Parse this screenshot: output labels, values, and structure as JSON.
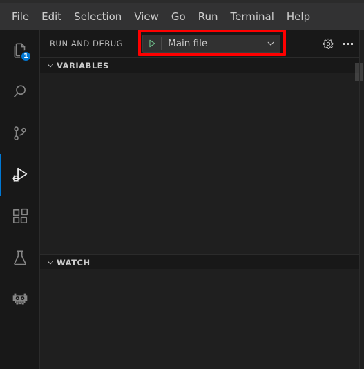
{
  "window": {
    "app": "Visual Studio Code",
    "theme_bg": "#1e1e1e",
    "accent": "#0078d4",
    "highlight_color": "#ff0000"
  },
  "menubar": {
    "items": [
      {
        "label": "File",
        "name": "menu-file"
      },
      {
        "label": "Edit",
        "name": "menu-edit"
      },
      {
        "label": "Selection",
        "name": "menu-selection"
      },
      {
        "label": "View",
        "name": "menu-view"
      },
      {
        "label": "Go",
        "name": "menu-go"
      },
      {
        "label": "Run",
        "name": "menu-run"
      },
      {
        "label": "Terminal",
        "name": "menu-terminal"
      },
      {
        "label": "Help",
        "name": "menu-help"
      }
    ]
  },
  "activitybar": {
    "items": [
      {
        "label": "Explorer",
        "icon": "files-icon",
        "badge": "1",
        "active": false
      },
      {
        "label": "Search",
        "icon": "search-icon",
        "badge": "",
        "active": false
      },
      {
        "label": "Source Control",
        "icon": "source-control-icon",
        "badge": "",
        "active": false
      },
      {
        "label": "Run and Debug",
        "icon": "run-and-debug-icon",
        "badge": "",
        "active": true
      },
      {
        "label": "Extensions",
        "icon": "extensions-icon",
        "badge": "",
        "active": false
      },
      {
        "label": "Testing",
        "icon": "beaker-icon",
        "badge": "",
        "active": false
      },
      {
        "label": "Godot Tools",
        "icon": "godot-icon",
        "badge": "",
        "active": false
      }
    ]
  },
  "sidebar": {
    "title": "Run and Debug",
    "config": {
      "value": "Main file",
      "start_icon": "play-icon",
      "start_color": "#6fcf6f",
      "chevron_icon": "chevron-down-icon",
      "highlighted": true
    },
    "actions": [
      {
        "label": "Open launch.json",
        "icon": "gear-icon"
      },
      {
        "label": "Views and More Actions...",
        "icon": "ellipsis-icon"
      }
    ],
    "sections": [
      {
        "title": "Variables",
        "expanded": true,
        "twisty": "chevron-down-icon",
        "content": ""
      },
      {
        "title": "Watch",
        "expanded": true,
        "twisty": "chevron-down-icon",
        "content": ""
      }
    ]
  }
}
